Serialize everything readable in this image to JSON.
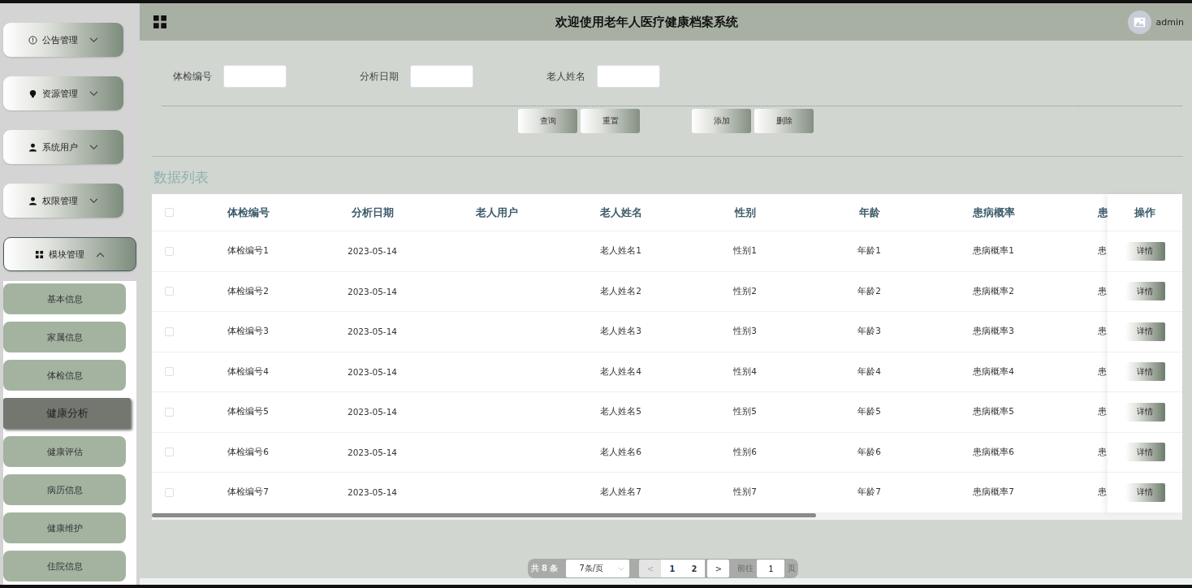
{
  "header": {
    "title": "欢迎使用老年人医疗健康档案系统",
    "user": "admin"
  },
  "sidebar": {
    "items": [
      {
        "label": "公告管理",
        "expanded": false
      },
      {
        "label": "资源管理",
        "expanded": false
      },
      {
        "label": "系统用户",
        "expanded": false
      },
      {
        "label": "权限管理",
        "expanded": false
      },
      {
        "label": "模块管理",
        "expanded": true,
        "children": [
          {
            "label": "基本信息",
            "selected": false
          },
          {
            "label": "家属信息",
            "selected": false
          },
          {
            "label": "体检信息",
            "selected": false
          },
          {
            "label": "健康分析",
            "selected": true
          },
          {
            "label": "健康评估",
            "selected": false
          },
          {
            "label": "病历信息",
            "selected": false
          },
          {
            "label": "健康维护",
            "selected": false
          },
          {
            "label": "住院信息",
            "selected": false
          }
        ]
      }
    ]
  },
  "search": {
    "fields": [
      {
        "label": "体检编号"
      },
      {
        "label": "分析日期"
      },
      {
        "label": "老人姓名"
      }
    ],
    "button_groups": [
      [
        "查询",
        "重置"
      ],
      [
        "添加",
        "删除"
      ]
    ]
  },
  "table": {
    "title": "数据列表",
    "all_checked": false,
    "columns": [
      "体检编号",
      "分析日期",
      "老人用户",
      "老人姓名",
      "性别",
      "年龄",
      "患病概率",
      "患"
    ],
    "action_column": "操作",
    "rows": [
      {
        "checked": false,
        "cells": [
          "体检编号1",
          "2023-05-14",
          null,
          "老人姓名1",
          "性别1",
          "年龄1",
          "患病概率1",
          "患"
        ],
        "action": "详情"
      },
      {
        "checked": false,
        "cells": [
          "体检编号2",
          "2023-05-14",
          null,
          "老人姓名2",
          "性别2",
          "年龄2",
          "患病概率2",
          "患"
        ],
        "action": "详情"
      },
      {
        "checked": false,
        "cells": [
          "体检编号3",
          "2023-05-14",
          null,
          "老人姓名3",
          "性别3",
          "年龄3",
          "患病概率3",
          "患"
        ],
        "action": "详情"
      },
      {
        "checked": false,
        "cells": [
          "体检编号4",
          "2023-05-14",
          null,
          "老人姓名4",
          "性别4",
          "年龄4",
          "患病概率4",
          "患"
        ],
        "action": "详情"
      },
      {
        "checked": false,
        "cells": [
          "体检编号5",
          "2023-05-14",
          null,
          "老人姓名5",
          "性别5",
          "年龄5",
          "患病概率5",
          "患"
        ],
        "action": "详情"
      },
      {
        "checked": false,
        "cells": [
          "体检编号6",
          "2023-05-14",
          null,
          "老人姓名6",
          "性别6",
          "年龄6",
          "患病概率6",
          "患"
        ],
        "action": "详情"
      },
      {
        "checked": false,
        "cells": [
          "体检编号7",
          "2023-05-14",
          null,
          "老人姓名7",
          "性别7",
          "年龄7",
          "患病概率7",
          "患"
        ],
        "action": "详情"
      }
    ]
  },
  "pagination": {
    "total": "共 8 条",
    "page_size": "7条/页",
    "prev": "<",
    "next": ">",
    "pages": [
      {
        "label": "1",
        "selected": true
      },
      {
        "label": "2",
        "selected": false
      }
    ],
    "goto_label": "前往",
    "goto_value": "1",
    "goto_suffix": "页"
  }
}
